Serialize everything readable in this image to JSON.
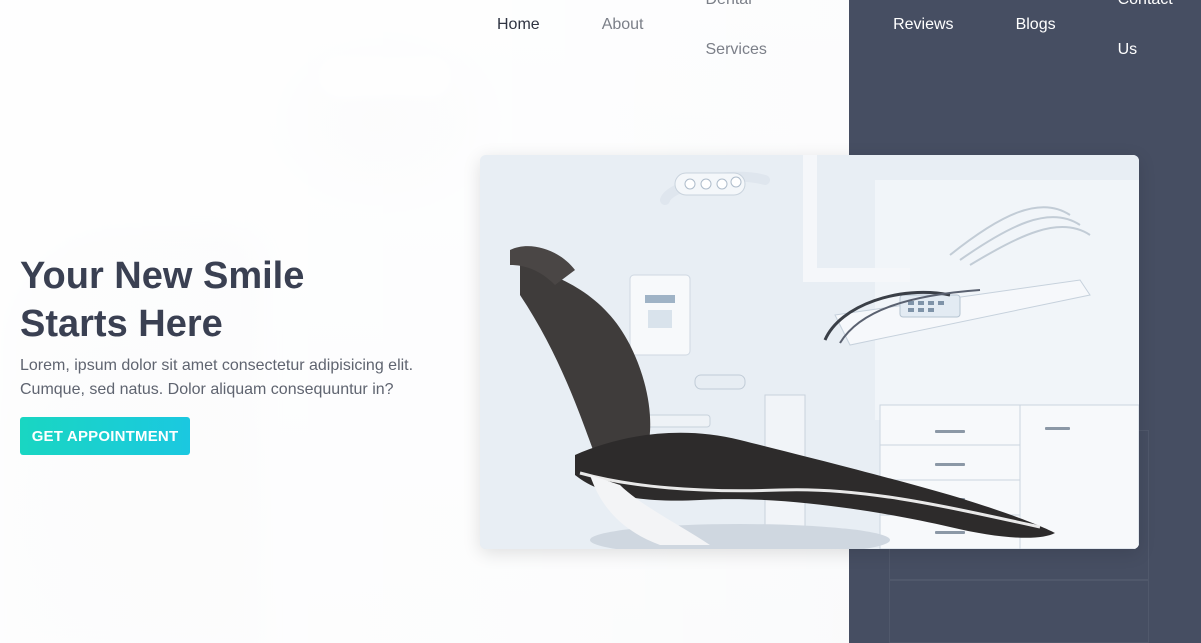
{
  "nav": {
    "items": [
      {
        "label": "Home"
      },
      {
        "label": "About"
      },
      {
        "label": "Dental Services"
      },
      {
        "label": "Reviews"
      },
      {
        "label": "Blogs"
      },
      {
        "label": "Contact Us"
      }
    ]
  },
  "hero": {
    "title_line1": "Your New Smile",
    "title_line2": "Starts Here",
    "text_line1": "Lorem, ipsum dolor sit amet consectetur adipisicing elit.",
    "text_line2": "Cumque, sed natus. Dolor aliquam consequuntur in?",
    "cta_label": "GET APPOINTMENT",
    "image_icon": "dental-chair-icon"
  },
  "colors": {
    "accent_start": "#19d6c2",
    "accent_end": "#1bc8e0",
    "dark_panel": "#464e62",
    "title": "#3a4052"
  }
}
